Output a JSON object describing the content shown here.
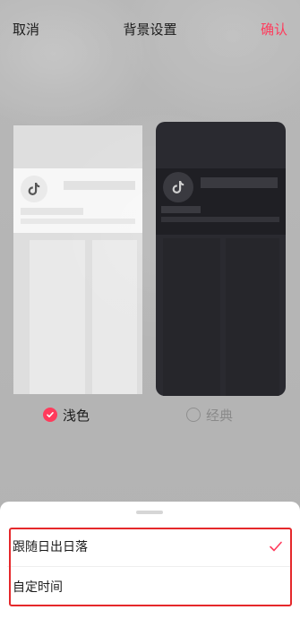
{
  "header": {
    "cancel_label": "取消",
    "title": "背景设置",
    "confirm_label": "确认"
  },
  "themes": [
    {
      "label": "浅色",
      "selected": true
    },
    {
      "label": "经典",
      "selected": false
    }
  ],
  "sheet": {
    "options": [
      {
        "label": "跟随日出日落",
        "selected": true
      },
      {
        "label": "自定时间",
        "selected": false
      }
    ]
  },
  "colors": {
    "accent": "#ff3b5c",
    "highlight_border": "#e5282b"
  }
}
